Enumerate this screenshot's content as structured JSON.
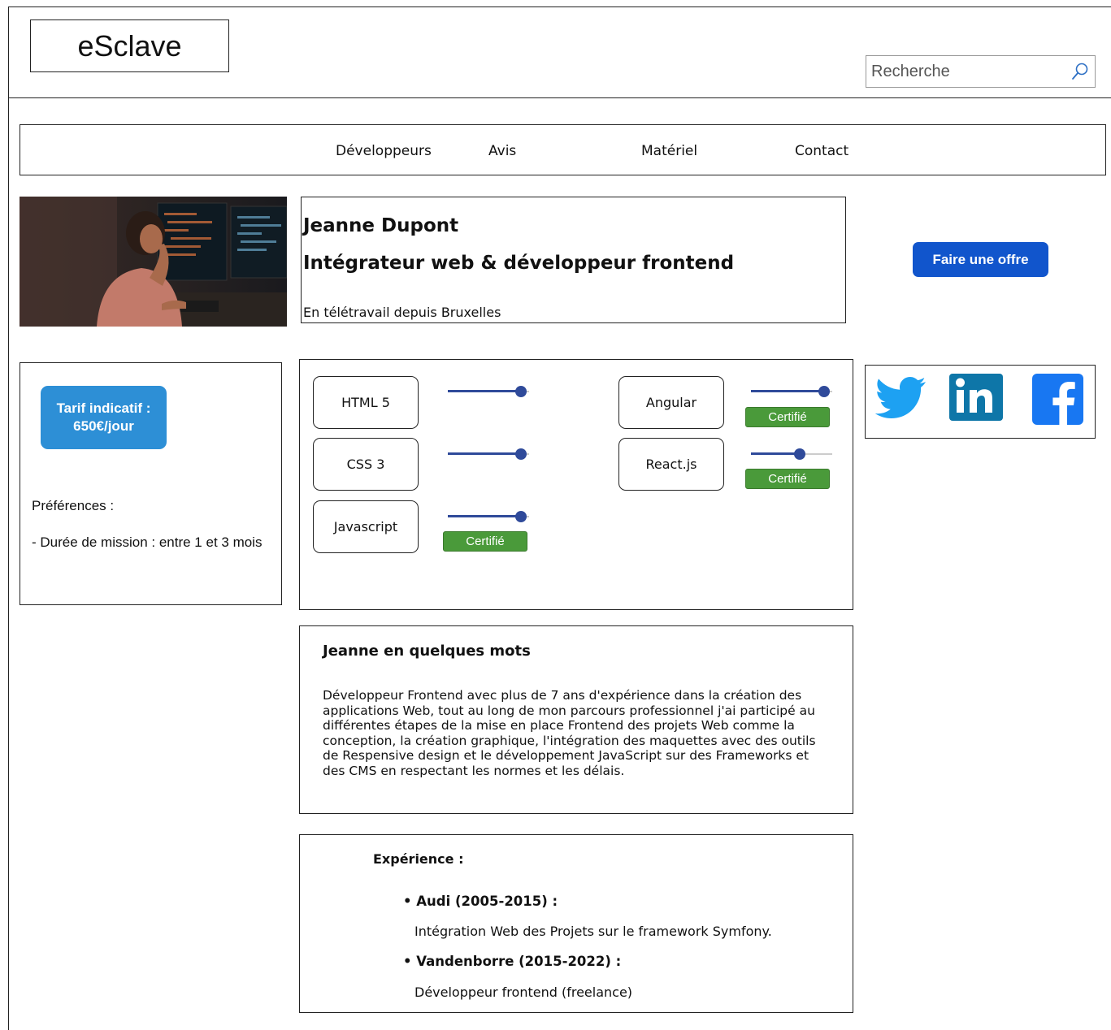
{
  "header": {
    "logo": "eSclave",
    "search_placeholder": "Recherche"
  },
  "nav": {
    "items": [
      "Développeurs",
      "Avis",
      "Matériel",
      "Contact"
    ]
  },
  "profile": {
    "name": "Jeanne Dupont",
    "title": "Intégrateur web & développeur frontend",
    "location": "En télétravail depuis Bruxelles",
    "offer_button": "Faire une offre"
  },
  "rate": {
    "line1": "Tarif indicatif :",
    "line2": "650€/jour"
  },
  "preferences": {
    "title": "Préférences :",
    "duration": "- Durée de mission : entre 1 et 3 mois"
  },
  "skills": [
    {
      "name": "HTML 5",
      "level": 0.9,
      "certified": false
    },
    {
      "name": "CSS 3",
      "level": 0.9,
      "certified": false
    },
    {
      "name": "Javascript",
      "level": 0.9,
      "certified": true
    },
    {
      "name": "Angular",
      "level": 0.9,
      "certified": true
    },
    {
      "name": "React.js",
      "level": 0.6,
      "certified": true
    }
  ],
  "certified_label": "Certifié",
  "social": [
    "twitter-icon",
    "linkedin-icon",
    "facebook-icon"
  ],
  "about": {
    "title": "Jeanne en quelques mots",
    "text": "Développeur Frontend avec plus de 7 ans d'expérience dans la création des applications Web, tout au long de mon parcours professionnel j'ai participé au différentes étapes de la mise en place Frontend des projets Web comme la conception, la création graphique, l'intégration des maquettes avec des outils de Respensive design et le développement JavaScript sur des Frameworks et des CMS en respectant les normes et les délais."
  },
  "experience": {
    "title": "Expérience :",
    "items": [
      {
        "heading": "• Audi (2005-2015) :",
        "desc": "Intégration Web des Projets sur le framework Symfony."
      },
      {
        "heading": "• Vandenborre (2015-2022) :",
        "desc": "Développeur frontend (freelance)"
      }
    ]
  },
  "colors": {
    "primary_button": "#1155cc",
    "rate_button": "#2d8fd6",
    "certified_badge": "#4a9a3a",
    "slider": "#2f4a9a",
    "twitter": "#1da1f2",
    "linkedin": "#0e76a8",
    "facebook": "#1877f2"
  }
}
